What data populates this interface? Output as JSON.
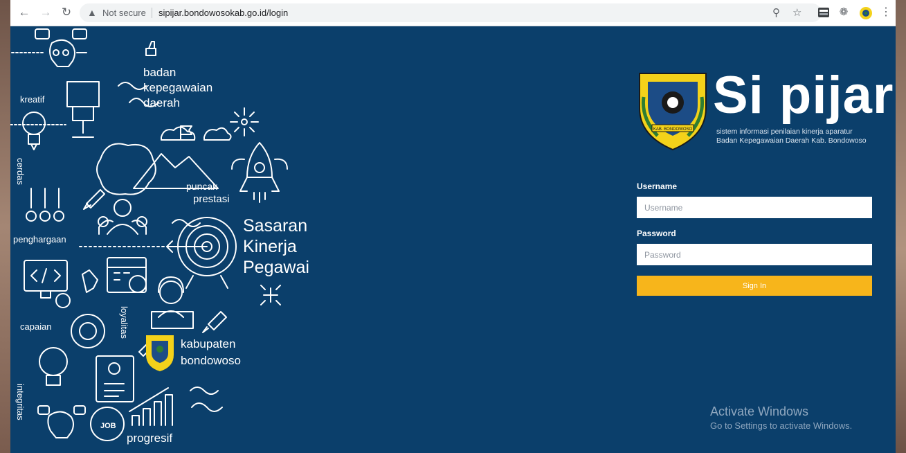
{
  "browser": {
    "nav": {
      "back_icon": "back-arrow-icon",
      "forward_icon": "forward-arrow-icon",
      "reload_icon": "reload-icon"
    },
    "omnibox": {
      "security_label": "Not secure",
      "url": "sipijar.bondowosokab.go.id/login",
      "zoom_icon": "zoom-icon",
      "star_icon": "bookmark-star-icon"
    },
    "extensions": [
      "news-extension-icon",
      "puzzle-extensions-icon",
      "profile-avatar-icon",
      "more-menu-icon"
    ]
  },
  "artwork": {
    "words": {
      "badan": "badan",
      "kepegawaian": "kepegawaian",
      "daerah": "daerah",
      "kreatif": "kreatif",
      "cerdas": "cerdas",
      "puncak": "puncak",
      "prestasi": "prestasi",
      "sasaran": "Sasaran",
      "kinerja": "Kinerja",
      "pegawai": "Pegawai",
      "penghargaan": "penghargaan",
      "capaian": "capaian",
      "loyalitas": "loyalitas",
      "kabupaten": "kabupaten",
      "bondowoso": "bondowoso",
      "integritas": "integritas",
      "job": "JOB",
      "progresif": "progresif"
    }
  },
  "brand": {
    "title": "Si pijar",
    "subtitle_line1": "sistem informasi penilaian kinerja aparatur",
    "subtitle_line2": "Badan Kepegawaian Daerah Kab. Bondowoso",
    "crest_text": "KAB. BONDOWOSO"
  },
  "login": {
    "username_label": "Username",
    "username_placeholder": "Username",
    "password_label": "Password",
    "password_placeholder": "Password",
    "submit_label": "Sign In"
  },
  "watermark": {
    "line1": "Activate Windows",
    "line2": "Go to Settings to activate Windows."
  },
  "colors": {
    "page_bg": "#0b3f6b",
    "button": "#f7b51b",
    "crest_yellow": "#f4d21a",
    "crest_blue": "#1c4c86"
  }
}
